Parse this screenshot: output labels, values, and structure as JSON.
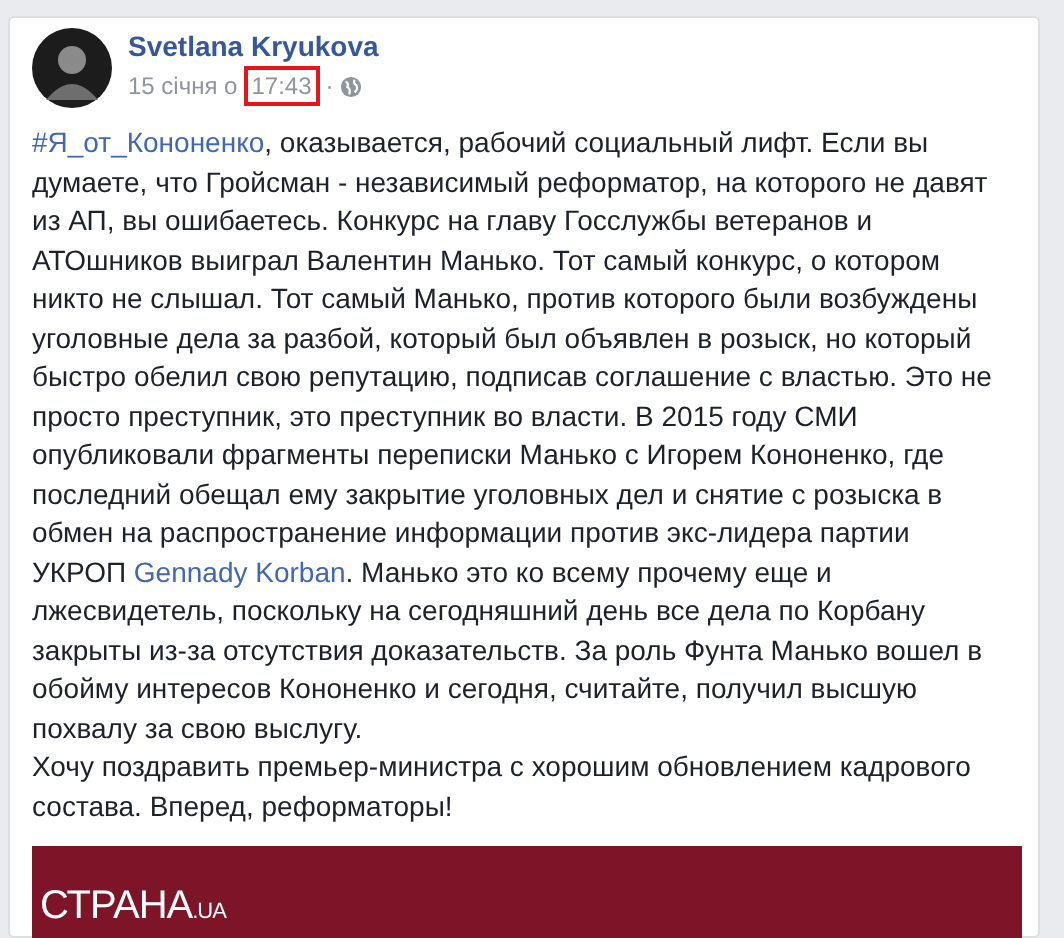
{
  "post": {
    "author": "Svetlana Kryukova",
    "date": "15 січня о",
    "time": "17:43",
    "time_highlighted": true,
    "separator": "·",
    "paragraphs": [
      [
        {
          "kind": "hashtag",
          "text": "#Я_от_Кононенко"
        },
        {
          "kind": "text",
          "text": ", оказывается, рабочий социальный лифт. Если вы думаете, что Гройсман - независимый реформатор, на которого не давят из АП, вы ошибаетесь. Конкурс на главу Госслужбы ветеранов и АТОшников выиграл Валентин Манько. Тот самый конкурс, о котором никто не слышал. Тот самый Манько, против которого были возбуждены уголовные дела за разбой, который был объявлен в розыск, но который быстро обелил свою репутацию, подписав соглашение с властью. Это не просто преступник, это преступник во власти. В 2015 году СМИ опубликовали фрагменты переписки Манько с Игорем Кононенко, где последний обещал ему закрытие уголовных дел и снятие с розыска в обмен на распространение информации против экс-лидера партии УКРОП "
        },
        {
          "kind": "mention",
          "text": "Gennady Korban"
        },
        {
          "kind": "text",
          "text": ". Манько это ко всему прочему еще и лжесвидетель, поскольку на сегодняшний день все дела по Корбану закрыты из-за отсутствия доказательств. За роль Фунта Манько вошел в обойму интересов Кононенко и сегодня, считайте, получил высшую похвалу за свою выслугу."
        }
      ],
      [
        {
          "kind": "text",
          "text": "Хочу поздравить премьер-министра с хорошим обновлением кадрового состава. Вперед, реформаторы!"
        }
      ]
    ],
    "preview": {
      "logo": "СТРАНА",
      "logo_suffix": ".UA"
    }
  }
}
